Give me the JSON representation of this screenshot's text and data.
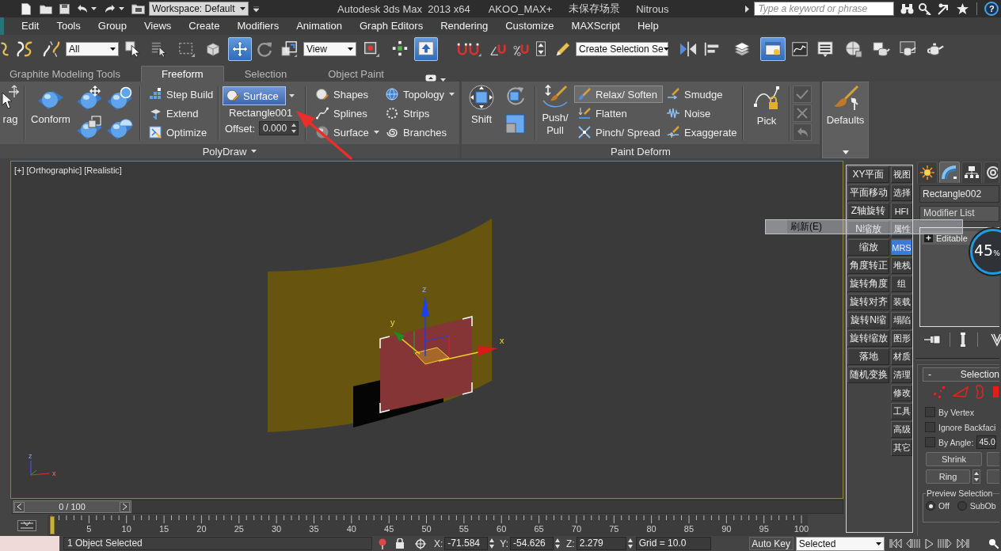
{
  "title_bar": {
    "workspace": "Workspace: Default",
    "app_title": "Autodesk 3ds Max  2013 x64",
    "project": "AKOO_MAX+",
    "scene": "未保存场景",
    "renderer": "Nitrous",
    "search": {
      "placeholder": "Type a keyword or phrase"
    },
    "help": "?"
  },
  "menu_bar": [
    "Edit",
    "Tools",
    "Group",
    "Views",
    "Create",
    "Modifiers",
    "Animation",
    "Graph Editors",
    "Rendering",
    "Customize",
    "MAXScript",
    "Help"
  ],
  "main_toolbar": {
    "selection_filter": "All",
    "reference_coordinate_system": "View",
    "named_selection_set": "Create Selection Se",
    "tools": [
      {
        "selected": false
      },
      {
        "selected": false
      },
      {
        "selected": false
      },
      {
        "selected": false
      },
      {
        "selected": false
      },
      {
        "selected": false
      },
      {
        "selected": false
      },
      {
        "selected": true
      },
      {
        "selected": false
      },
      {
        "selected": false
      },
      {
        "selected": false
      },
      {
        "selected": false
      },
      {
        "selected": true
      },
      {
        "selected": false
      },
      {
        "selected": false
      },
      {
        "selected": false
      },
      {
        "selected": false
      },
      {
        "selected": false
      },
      {
        "selected": false
      },
      {
        "selected": false
      },
      {
        "selected": false
      },
      {
        "selected": true
      },
      {
        "selected": false
      },
      {
        "selected": false
      },
      {
        "selected": false
      },
      {
        "selected": false
      },
      {
        "selected": false
      },
      {
        "selected": false
      }
    ]
  },
  "ribbon": {
    "tabs": [
      {
        "label": "Graphite Modeling Tools",
        "selected": false
      },
      {
        "label": "Freeform",
        "selected": true
      },
      {
        "label": "Selection",
        "selected": false
      },
      {
        "label": "Object Paint",
        "selected": false
      }
    ],
    "polydraw": {
      "title": "PolyDraw",
      "drag": "rag",
      "conform": "Conform",
      "tools": [
        "Step Build",
        "Extend",
        "Optimize"
      ],
      "draw_on": {
        "label": "Surface",
        "selected": true
      },
      "picked_object": "Rectangle001",
      "offset": {
        "label": "Offset:",
        "value": "0.000"
      },
      "shapes": [
        {
          "label": "Shapes",
          "dropdown": false
        },
        {
          "label": "Splines",
          "dropdown": false
        },
        {
          "label": "Surface",
          "dropdown": true
        },
        {
          "label": "Topology",
          "dropdown": true
        },
        {
          "label": "Strips",
          "dropdown": false
        },
        {
          "label": "Branches",
          "dropdown": false
        }
      ]
    },
    "paint_deform": {
      "title": "Paint Deform",
      "shift": "Shift",
      "push_pull": "Push/ Pull",
      "brushes": [
        {
          "label": "Relax/ Soften",
          "selected": true
        },
        {
          "label": "Flatten",
          "selected": false
        },
        {
          "label": "Pinch/ Spread",
          "selected": false
        },
        {
          "label": "Smudge",
          "selected": false
        },
        {
          "label": "Noise",
          "selected": false
        },
        {
          "label": "Exaggerate",
          "selected": false
        }
      ],
      "pick": "Pick",
      "actions": [
        {
          "disabled": true
        },
        {
          "disabled": true
        },
        {
          "disabled": true
        }
      ]
    },
    "defaults": "Defaults"
  },
  "viewport": {
    "labels": [
      "[+]",
      "[Orthographic]",
      "[Realistic]"
    ],
    "gizmo_axes": [
      "x",
      "y",
      "z"
    ],
    "tripod_axes": [
      "z",
      "x"
    ]
  },
  "context_menu": {
    "items": [
      "刷新(E)"
    ]
  },
  "script_panel": {
    "left": [
      "XY平面",
      "平面移动",
      "Z轴旋转",
      "N缩放",
      "缩放",
      "角度转正",
      "旋转角度",
      "旋转对齐",
      "旋转N缩",
      "旋转缩放",
      "落地",
      "随机变换"
    ],
    "right": [
      {
        "label": "视图",
        "selected": false
      },
      {
        "label": "选择",
        "selected": false
      },
      {
        "label": "HFI",
        "selected": false
      },
      {
        "label": "属性",
        "selected": false
      },
      {
        "label": "MRS",
        "selected": true
      },
      {
        "label": "堆栈",
        "selected": false
      },
      {
        "label": "组",
        "selected": false
      },
      {
        "label": "装载",
        "selected": false
      },
      {
        "label": "塌陷",
        "selected": false
      },
      {
        "label": "图形",
        "selected": false
      },
      {
        "label": "材质",
        "selected": false
      },
      {
        "label": "清理",
        "selected": false
      },
      {
        "label": "修改",
        "selected": false
      },
      {
        "label": "工具",
        "selected": false
      },
      {
        "label": "高级",
        "selected": false
      },
      {
        "label": "其它",
        "selected": false
      }
    ]
  },
  "command_panel": {
    "tabs": [
      {
        "selected": false
      },
      {
        "selected": true
      },
      {
        "selected": false
      },
      {
        "selected": false
      }
    ],
    "object_name": "Rectangle002",
    "modifier_list": "Modifier List",
    "stack": [
      {
        "label": "Editable",
        "expanded": false
      }
    ],
    "usage_meter": {
      "value": "45",
      "unit": "%"
    },
    "selection": {
      "sign": "-",
      "title": "Selection",
      "options": [
        {
          "label": "By Vertex",
          "checked": false
        },
        {
          "label": "Ignore Backfaci",
          "checked": false
        },
        {
          "label": "By Angle:",
          "checked": false
        }
      ],
      "angle": "45.0",
      "buttons": [
        "Shrink",
        "Ring"
      ],
      "preview": {
        "title": "Preview Selection",
        "options": [
          {
            "label": "Off",
            "selected": true
          },
          {
            "label": "SubOb",
            "selected": false
          }
        ]
      }
    }
  },
  "timeline": {
    "frame": "0 / 100",
    "ruler": [
      "5",
      "10",
      "15",
      "20",
      "25",
      "30",
      "35",
      "40",
      "45",
      "50",
      "55",
      "60",
      "65",
      "70",
      "75",
      "80",
      "85",
      "90",
      "95",
      "100"
    ]
  },
  "status_bar": {
    "message": "1 Object Selected",
    "coordinates": [
      {
        "axis": "X:",
        "value": "-71.584"
      },
      {
        "axis": "Y:",
        "value": "-54.626"
      },
      {
        "axis": "Z:",
        "value": "2.279"
      }
    ],
    "grid": "Grid = 10.0",
    "auto_key": "Auto Key",
    "key_filter": "Selected"
  }
}
